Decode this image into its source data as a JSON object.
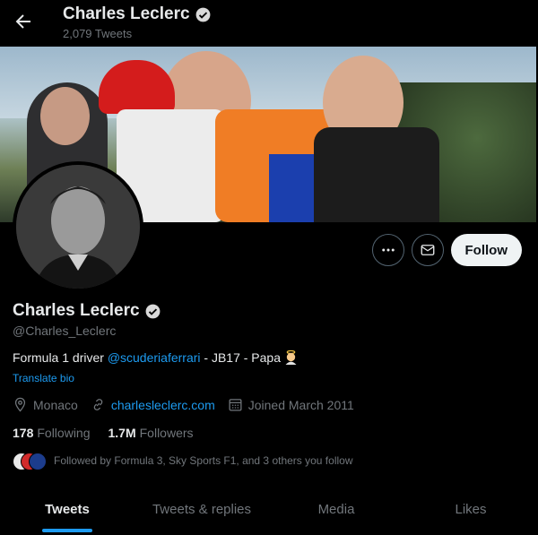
{
  "header": {
    "name": "Charles Leclerc",
    "tweet_count": "2,079 Tweets"
  },
  "actions": {
    "follow_label": "Follow"
  },
  "profile": {
    "name": "Charles Leclerc",
    "handle": "@Charles_Leclerc",
    "bio_prefix": "Formula 1 driver ",
    "bio_mention": "@scuderiaferrari",
    "bio_suffix": " - JB17 - Papa",
    "translate_label": "Translate bio",
    "location": "Monaco",
    "website": "charlesleclerc.com",
    "joined": "Joined March 2011",
    "following_count": "178",
    "following_label": "Following",
    "followers_count": "1.7M",
    "followers_label": "Followers",
    "followed_by": "Followed by Formula 3, Sky Sports F1, and 3 others you follow"
  },
  "tabs": [
    {
      "label": "Tweets",
      "active": true
    },
    {
      "label": "Tweets & replies",
      "active": false
    },
    {
      "label": "Media",
      "active": false
    },
    {
      "label": "Likes",
      "active": false
    }
  ],
  "colors": {
    "accent": "#1d9bf0",
    "background": "#000000",
    "text_primary": "#e7e9ea",
    "text_secondary": "#71767b"
  },
  "icons": {
    "back": "arrow-left-icon",
    "verified": "verified-badge-icon",
    "more": "more-icon",
    "message": "envelope-icon",
    "location": "location-pin-icon",
    "link": "link-icon",
    "calendar": "calendar-icon"
  }
}
